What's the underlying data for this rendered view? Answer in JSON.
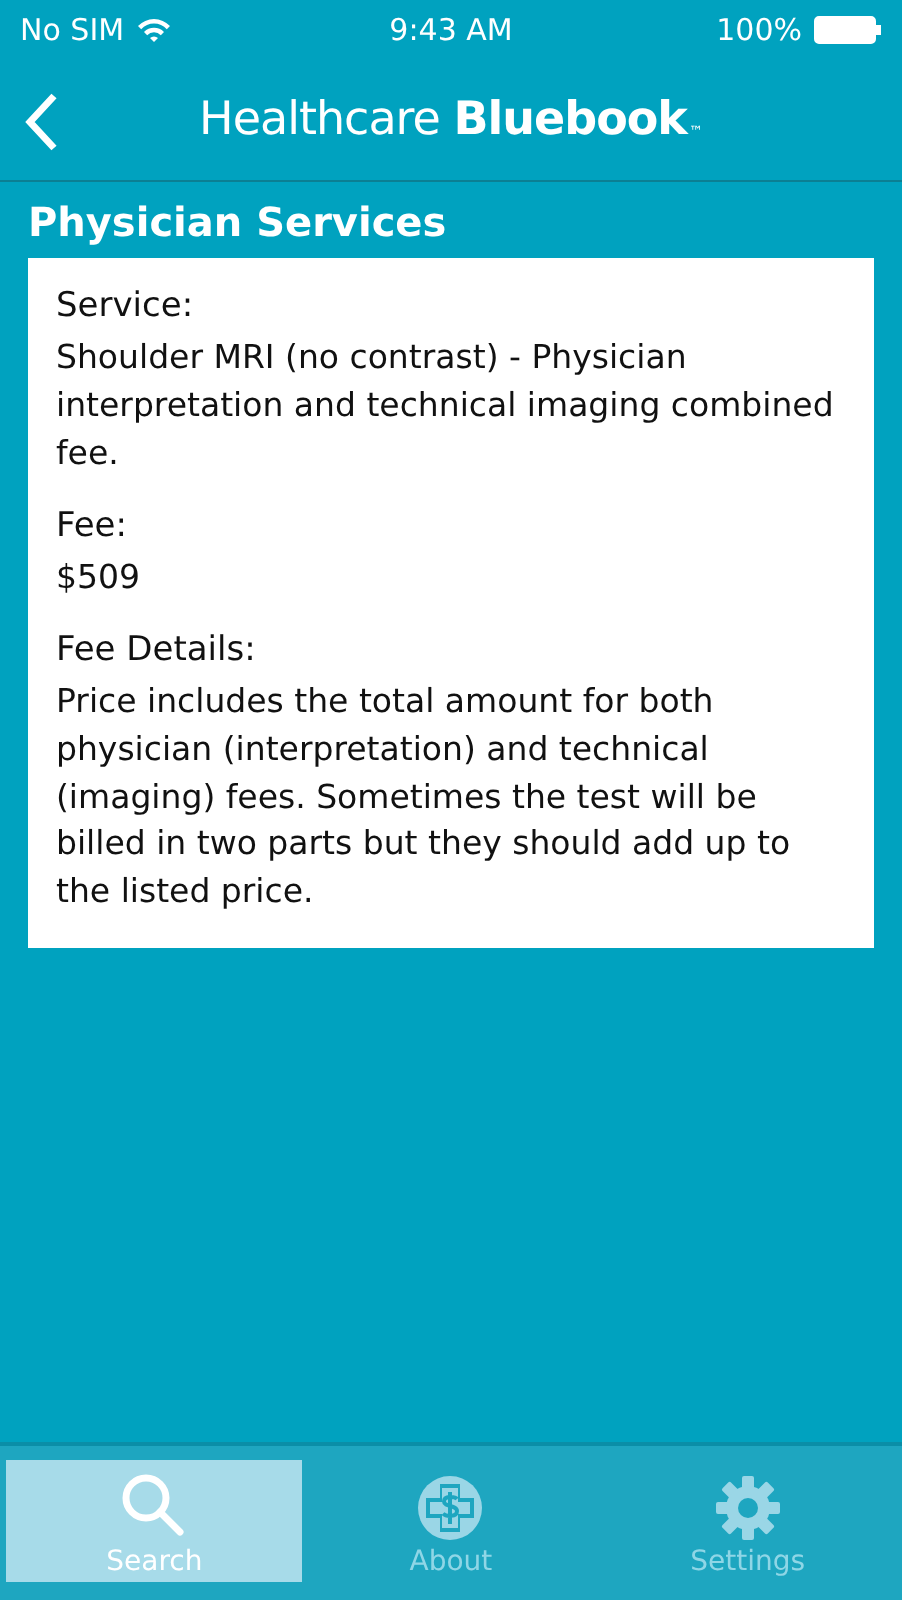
{
  "status_bar": {
    "carrier": "No SIM",
    "time": "9:43 AM",
    "battery": "100%"
  },
  "header": {
    "brand": "Healthcare **Bluebook**",
    "trademark": "™"
  },
  "section_title": "Physician Services",
  "details": [
    {
      "label": "Service:",
      "value": "Shoulder MRI (no contrast) - Physician interpretation and technical imaging combined fee."
    },
    {
      "label": "Fee:",
      "value": "$509"
    },
    {
      "label": "Fee Details:",
      "value": "Price includes the total amount for both physician (interpretation) and technical (imaging) fees. Sometimes the test will be billed in two parts but they should add up to the listed price."
    }
  ],
  "tabs": [
    {
      "label": "Search",
      "kind": "search",
      "selected": true
    },
    {
      "label": "About",
      "kind": "about",
      "selected": false
    },
    {
      "label": "Settings",
      "kind": "settings",
      "selected": false
    }
  ]
}
